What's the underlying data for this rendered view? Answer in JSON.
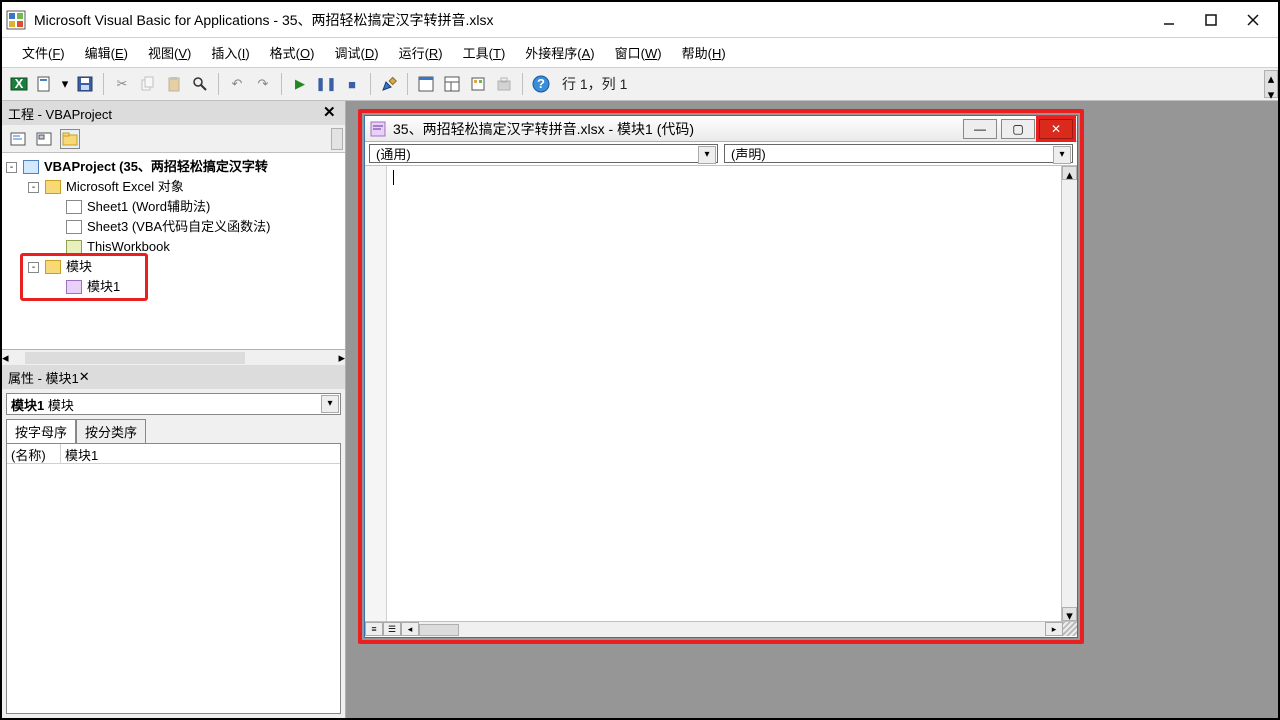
{
  "title": "Microsoft Visual Basic for Applications - 35、两招轻松搞定汉字转拼音.xlsx",
  "menus": {
    "file": "文件(",
    "file_u": "F",
    "file_e": ")",
    "edit": "编辑(",
    "edit_u": "E",
    "edit_e": ")",
    "view": "视图(",
    "view_u": "V",
    "view_e": ")",
    "insert": "插入(",
    "insert_u": "I",
    "insert_e": ")",
    "format": "格式(",
    "format_u": "O",
    "format_e": ")",
    "debug": "调试(",
    "debug_u": "D",
    "debug_e": ")",
    "run": "运行(",
    "run_u": "R",
    "run_e": ")",
    "tools": "工具(",
    "tools_u": "T",
    "tools_e": ")",
    "addins": "外接程序(",
    "addins_u": "A",
    "addins_e": ")",
    "window": "窗口(",
    "window_u": "W",
    "window_e": ")",
    "help": "帮助(",
    "help_u": "H",
    "help_e": ")"
  },
  "status_bar": "行 1，列 1",
  "project_panel": {
    "title": "工程 - VBAProject",
    "root": "VBAProject (35、两招轻松搞定汉字转",
    "excel_objects": "Microsoft Excel 对象",
    "sheet1": "Sheet1 (Word辅助法)",
    "sheet3": "Sheet3 (VBA代码自定义函数法)",
    "thiswb": "ThisWorkbook",
    "modules": "模块",
    "module1": "模块1"
  },
  "properties_panel": {
    "title": "属性 - 模块1",
    "sel_name": "模块1",
    "sel_type": "模块",
    "tab_alpha": "按字母序",
    "tab_cat": "按分类序",
    "row_name_k": "(名称)",
    "row_name_v": "模块1"
  },
  "code_window": {
    "title": "35、两招轻松搞定汉字转拼音.xlsx - 模块1 (代码)",
    "left_combo": "(通用)",
    "right_combo": "(声明)"
  }
}
